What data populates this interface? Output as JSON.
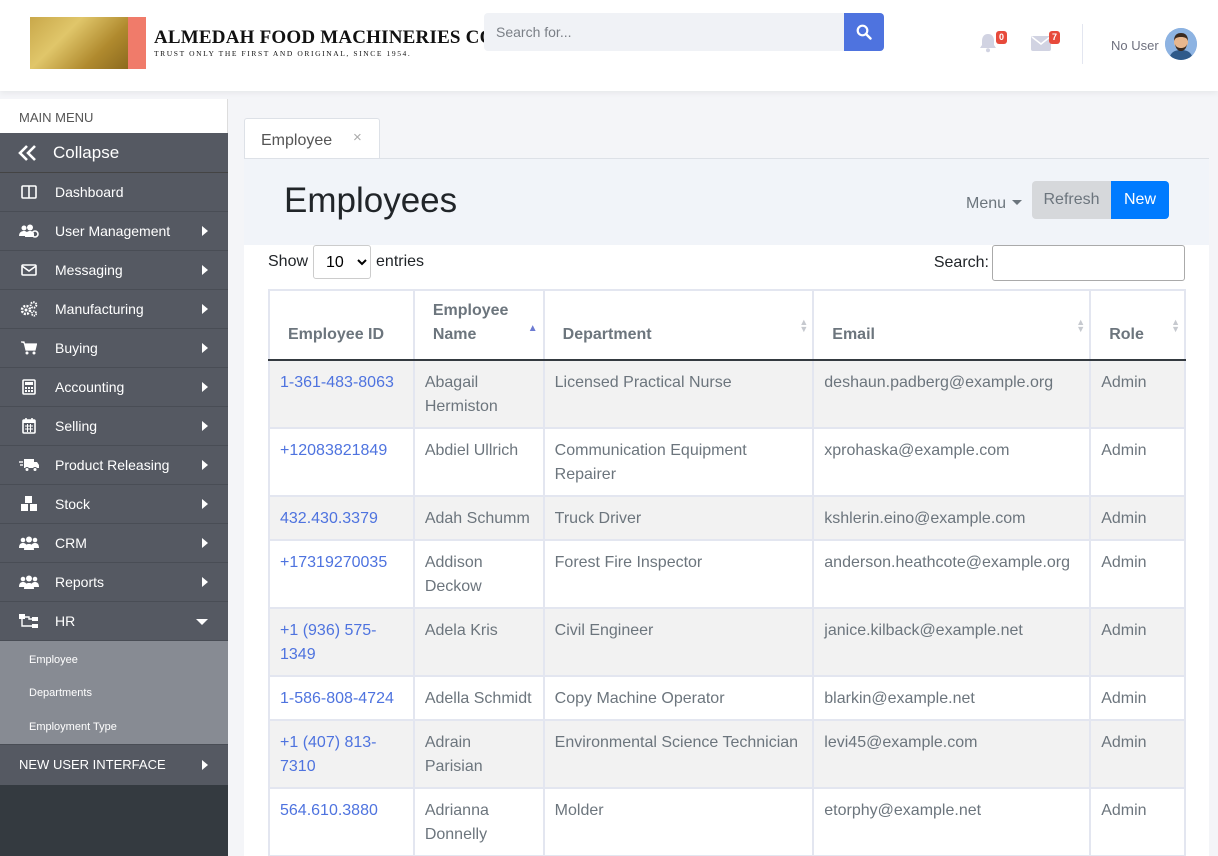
{
  "header": {
    "company_name": "ALMEDAH FOOD MACHINERIES CORP.",
    "company_tagline": "TRUST ONLY THE FIRST AND ORIGINAL, SINCE 1954.",
    "search_placeholder": "Search for...",
    "notifications_count": "0",
    "messages_count": "7",
    "user_name": "No User"
  },
  "sidebar": {
    "main_menu_label": "MAIN MENU",
    "collapse_label": "Collapse",
    "items": [
      {
        "label": "Dashboard",
        "icon": "columns-icon",
        "has_submenu": false
      },
      {
        "label": "User Management",
        "icon": "users-cog-icon",
        "has_submenu": true
      },
      {
        "label": "Messaging",
        "icon": "envelope-icon",
        "has_submenu": true
      },
      {
        "label": "Manufacturing",
        "icon": "cogs-icon",
        "has_submenu": true
      },
      {
        "label": "Buying",
        "icon": "cart-icon",
        "has_submenu": true
      },
      {
        "label": "Accounting",
        "icon": "calculator-icon",
        "has_submenu": true
      },
      {
        "label": "Selling",
        "icon": "calendar-icon",
        "has_submenu": true
      },
      {
        "label": "Product Releasing",
        "icon": "truck-icon",
        "has_submenu": true
      },
      {
        "label": "Stock",
        "icon": "boxes-icon",
        "has_submenu": true
      },
      {
        "label": "CRM",
        "icon": "people-icon",
        "has_submenu": true
      },
      {
        "label": "Reports",
        "icon": "people-group-icon",
        "has_submenu": true
      },
      {
        "label": "HR",
        "icon": "sitemap-icon",
        "has_submenu": true,
        "expanded": true
      }
    ],
    "hr_submenu": [
      "Employee",
      "Departments",
      "Employment Type"
    ],
    "new_ui_label": "NEW USER INTERFACE"
  },
  "tab": {
    "label": "Employee",
    "close": "×"
  },
  "page": {
    "title": "Employees",
    "menu_label": "Menu",
    "refresh_label": "Refresh",
    "new_label": "New"
  },
  "table_controls": {
    "show_label": "Show",
    "entries_value": "10",
    "entries_label": "entries",
    "search_label": "Search:"
  },
  "table": {
    "columns": [
      "Employee ID",
      "Employee Name",
      "Department",
      "Email",
      "Role"
    ],
    "sorted_column": "Employee Name",
    "rows": [
      {
        "id": "1-361-483-8063",
        "name": "Abagail Hermiston",
        "department": "Licensed Practical Nurse",
        "email": "deshaun.padberg@example.org",
        "role": "Admin"
      },
      {
        "id": "+12083821849",
        "name": "Abdiel Ullrich",
        "department": "Communication Equipment Repairer",
        "email": "xprohaska@example.com",
        "role": "Admin"
      },
      {
        "id": "432.430.3379",
        "name": "Adah Schumm",
        "department": "Truck Driver",
        "email": "kshlerin.eino@example.com",
        "role": "Admin"
      },
      {
        "id": "+17319270035",
        "name": "Addison Deckow",
        "department": "Forest Fire Inspector",
        "email": "anderson.heathcote@example.org",
        "role": "Admin"
      },
      {
        "id": "+1 (936) 575-1349",
        "name": "Adela Kris",
        "department": "Civil Engineer",
        "email": "janice.kilback@example.net",
        "role": "Admin"
      },
      {
        "id": "1-586-808-4724",
        "name": "Adella Schmidt",
        "department": "Copy Machine Operator",
        "email": "blarkin@example.net",
        "role": "Admin"
      },
      {
        "id": "+1 (407) 813-7310",
        "name": "Adrain Parisian",
        "department": "Environmental Science Technician",
        "email": "levi45@example.com",
        "role": "Admin"
      },
      {
        "id": "564.610.3880",
        "name": "Adrianna Donnelly",
        "department": "Molder",
        "email": "etorphy@example.net",
        "role": "Admin"
      }
    ]
  }
}
